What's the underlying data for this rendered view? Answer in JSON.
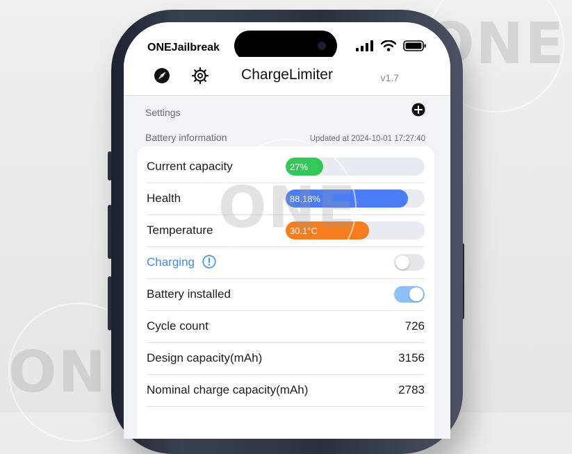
{
  "watermark": {
    "text": "ONE"
  },
  "status_bar": {
    "carrier": "ONEJailbreak"
  },
  "nav": {
    "title": "ChargeLimiter",
    "version": "v1.7",
    "left_icons": [
      "compass-icon",
      "gear-icon"
    ]
  },
  "sections": {
    "settings": "Settings",
    "battery": "Battery information",
    "updated": "Updated at 2024-10-01 17:27:40"
  },
  "battery_info": {
    "current_capacity": {
      "label": "Current capacity",
      "value_text": "27%",
      "fraction": 0.27,
      "color": "#34c759"
    },
    "health": {
      "label": "Health",
      "value_text": "88.18%",
      "fraction": 0.8818,
      "color": "#4a7df5"
    },
    "temperature": {
      "label": "Temperature",
      "value_text": "30.1°C",
      "fraction": 0.6,
      "color": "#f57c1f"
    },
    "charging": {
      "label": "Charging",
      "on": false
    },
    "battery_installed": {
      "label": "Battery installed",
      "on": true
    },
    "cycle_count": {
      "label": "Cycle count",
      "value": "726"
    },
    "design_capacity": {
      "label": "Design capacity(mAh)",
      "value": "3156"
    },
    "nominal_capacity": {
      "label": "Nominal charge capacity(mAh)",
      "value": "2783"
    }
  },
  "colors": {
    "toggle_on": "#8ec2f7",
    "toggle_off": "#e6e6ea",
    "link_blue": "#3a8ee6"
  }
}
